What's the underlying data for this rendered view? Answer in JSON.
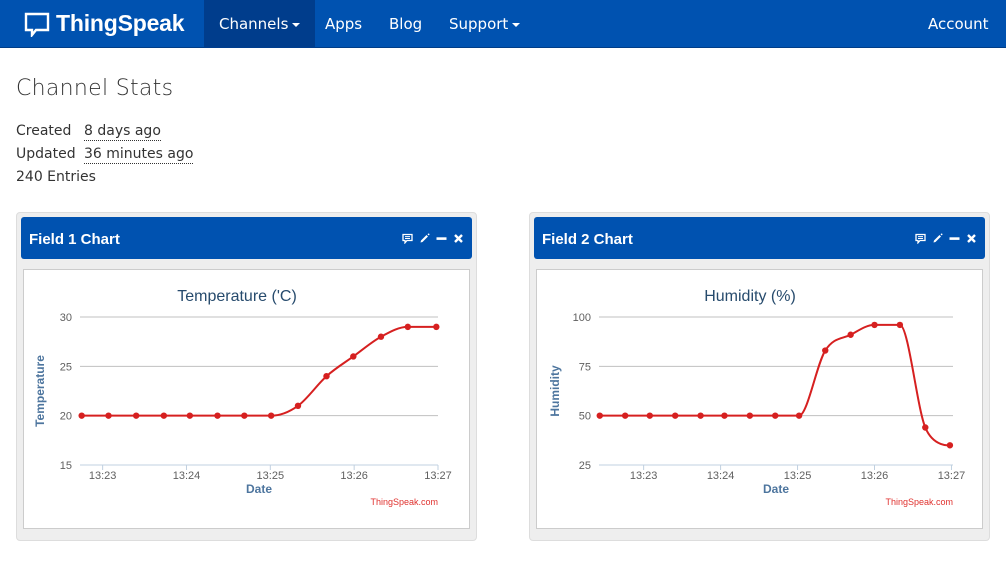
{
  "navbar": {
    "brand": "ThingSpeak",
    "items": [
      {
        "label": "Channels",
        "dropdown": true,
        "active": true
      },
      {
        "label": "Apps",
        "dropdown": false
      },
      {
        "label": "Blog",
        "dropdown": false
      },
      {
        "label": "Support",
        "dropdown": true
      }
    ],
    "account": {
      "label": "Account",
      "dropdown": true
    }
  },
  "colors": {
    "brand_blue": "#0052b0",
    "active_nav": "#003d8c",
    "series_red": "#d62020",
    "axis_title_blue": "#4d759e",
    "chart_title": "#274b6d"
  },
  "stats": {
    "title": "Channel Stats",
    "created_label": "Created",
    "created_value": "8 days ago",
    "updated_label": "Updated",
    "updated_value": "36 minutes ago",
    "entries": "240 Entries"
  },
  "panels": [
    {
      "title": "Field 1 Chart",
      "icons": [
        "comment-icon",
        "pencil-icon",
        "minimize-icon",
        "close-icon"
      ]
    },
    {
      "title": "Field 2 Chart",
      "icons": [
        "comment-icon",
        "pencil-icon",
        "minimize-icon",
        "close-icon"
      ]
    }
  ],
  "chart_data": [
    {
      "type": "line",
      "title": "Temperature ('C)",
      "xlabel": "Date",
      "ylabel": "Temperature",
      "credit": "ThingSpeak.com",
      "ylim": [
        15,
        30
      ],
      "yticks": [
        15,
        20,
        25,
        30
      ],
      "xlim_minutes": [
        22.73,
        27.0
      ],
      "xticks": [
        {
          "label": "13:23",
          "minute": 23
        },
        {
          "label": "13:24",
          "minute": 24
        },
        {
          "label": "13:25",
          "minute": 25
        },
        {
          "label": "13:26",
          "minute": 26
        },
        {
          "label": "13:27",
          "minute": 27
        }
      ],
      "grid": true,
      "legend": "none",
      "series": [
        {
          "name": "Temperature",
          "color": "#d62020",
          "x_minutes": [
            22.75,
            23.07,
            23.4,
            23.73,
            24.04,
            24.37,
            24.69,
            25.01,
            25.33,
            25.67,
            25.99,
            26.32,
            26.64,
            26.98
          ],
          "values": [
            20,
            20,
            20,
            20,
            20,
            20,
            20,
            20,
            21,
            24,
            26,
            28,
            29,
            29
          ]
        }
      ]
    },
    {
      "type": "line",
      "title": "Humidity (%)",
      "xlabel": "Date",
      "ylabel": "Humidity",
      "credit": "ThingSpeak.com",
      "ylim": [
        25,
        100
      ],
      "yticks": [
        25,
        50,
        75,
        100
      ],
      "xlim_minutes": [
        22.42,
        27.02
      ],
      "xticks": [
        {
          "label": "13:23",
          "minute": 23
        },
        {
          "label": "13:24",
          "minute": 24
        },
        {
          "label": "13:25",
          "minute": 25
        },
        {
          "label": "13:26",
          "minute": 26
        },
        {
          "label": "13:27",
          "minute": 27
        }
      ],
      "grid": true,
      "legend": "none",
      "series": [
        {
          "name": "Humidity",
          "color": "#d62020",
          "x_minutes": [
            22.43,
            22.76,
            23.08,
            23.41,
            23.74,
            24.05,
            24.38,
            24.71,
            25.02,
            25.36,
            25.69,
            26.0,
            26.33,
            26.66,
            26.98
          ],
          "values": [
            50,
            50,
            50,
            50,
            50,
            50,
            50,
            50,
            50,
            83,
            91,
            96,
            96,
            44,
            35
          ]
        }
      ]
    }
  ]
}
